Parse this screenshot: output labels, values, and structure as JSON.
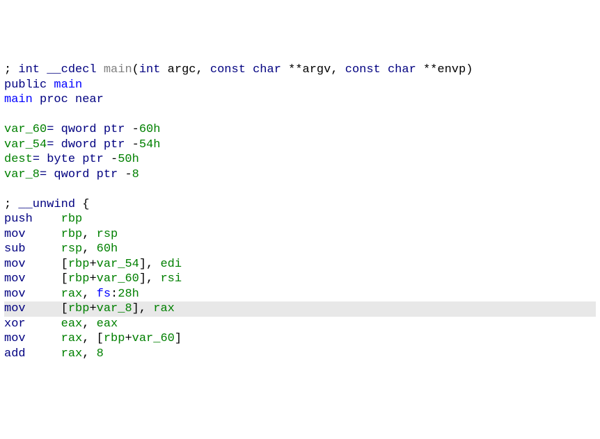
{
  "lines": [
    {
      "hl": false,
      "segs": [
        {
          "c": "t-black",
          "t": "; "
        },
        {
          "c": "t-navy",
          "t": "int"
        },
        {
          "c": "t-black",
          "t": " "
        },
        {
          "c": "t-navy",
          "t": "__cdecl"
        },
        {
          "c": "t-black",
          "t": " "
        },
        {
          "c": "t-gray",
          "t": "main"
        },
        {
          "c": "t-black",
          "t": "("
        },
        {
          "c": "t-navy",
          "t": "int"
        },
        {
          "c": "t-black",
          "t": " argc, "
        },
        {
          "c": "t-navy",
          "t": "const char"
        },
        {
          "c": "t-black",
          "t": " **argv, "
        },
        {
          "c": "t-navy",
          "t": "const char"
        },
        {
          "c": "t-black",
          "t": " **envp)"
        }
      ]
    },
    {
      "hl": false,
      "segs": [
        {
          "c": "t-navy",
          "t": "public"
        },
        {
          "c": "t-black",
          "t": " "
        },
        {
          "c": "t-blue",
          "t": "main"
        }
      ]
    },
    {
      "hl": false,
      "segs": [
        {
          "c": "t-blue",
          "t": "main"
        },
        {
          "c": "t-black",
          "t": " "
        },
        {
          "c": "t-navy",
          "t": "proc near"
        }
      ]
    },
    {
      "hl": false,
      "segs": [
        {
          "c": "t-black",
          "t": " "
        }
      ]
    },
    {
      "hl": false,
      "segs": [
        {
          "c": "t-green",
          "t": "var_60"
        },
        {
          "c": "t-navy",
          "t": "= qword ptr "
        },
        {
          "c": "t-black",
          "t": "-"
        },
        {
          "c": "t-green",
          "t": "60h"
        }
      ]
    },
    {
      "hl": false,
      "segs": [
        {
          "c": "t-green",
          "t": "var_54"
        },
        {
          "c": "t-navy",
          "t": "= dword ptr "
        },
        {
          "c": "t-black",
          "t": "-"
        },
        {
          "c": "t-green",
          "t": "54h"
        }
      ]
    },
    {
      "hl": false,
      "segs": [
        {
          "c": "t-green",
          "t": "dest"
        },
        {
          "c": "t-navy",
          "t": "= byte ptr "
        },
        {
          "c": "t-black",
          "t": "-"
        },
        {
          "c": "t-green",
          "t": "50h"
        }
      ]
    },
    {
      "hl": false,
      "segs": [
        {
          "c": "t-green",
          "t": "var_8"
        },
        {
          "c": "t-navy",
          "t": "= qword ptr "
        },
        {
          "c": "t-black",
          "t": "-"
        },
        {
          "c": "t-green",
          "t": "8"
        }
      ]
    },
    {
      "hl": false,
      "segs": [
        {
          "c": "t-black",
          "t": " "
        }
      ]
    },
    {
      "hl": false,
      "segs": [
        {
          "c": "t-black",
          "t": "; "
        },
        {
          "c": "t-navy",
          "t": "__unwind"
        },
        {
          "c": "t-black",
          "t": " {"
        }
      ]
    },
    {
      "hl": false,
      "segs": [
        {
          "c": "t-navy",
          "t": "push    "
        },
        {
          "c": "t-green",
          "t": "rbp"
        }
      ]
    },
    {
      "hl": false,
      "segs": [
        {
          "c": "t-navy",
          "t": "mov     "
        },
        {
          "c": "t-green",
          "t": "rbp"
        },
        {
          "c": "t-black",
          "t": ", "
        },
        {
          "c": "t-green",
          "t": "rsp"
        }
      ]
    },
    {
      "hl": false,
      "segs": [
        {
          "c": "t-navy",
          "t": "sub     "
        },
        {
          "c": "t-green",
          "t": "rsp"
        },
        {
          "c": "t-black",
          "t": ", "
        },
        {
          "c": "t-green",
          "t": "60h"
        }
      ]
    },
    {
      "hl": false,
      "segs": [
        {
          "c": "t-navy",
          "t": "mov     "
        },
        {
          "c": "t-black",
          "t": "["
        },
        {
          "c": "t-green",
          "t": "rbp"
        },
        {
          "c": "t-black",
          "t": "+"
        },
        {
          "c": "t-green",
          "t": "var_54"
        },
        {
          "c": "t-black",
          "t": "], "
        },
        {
          "c": "t-green",
          "t": "edi"
        }
      ]
    },
    {
      "hl": false,
      "segs": [
        {
          "c": "t-navy",
          "t": "mov     "
        },
        {
          "c": "t-black",
          "t": "["
        },
        {
          "c": "t-green",
          "t": "rbp"
        },
        {
          "c": "t-black",
          "t": "+"
        },
        {
          "c": "t-green",
          "t": "var_60"
        },
        {
          "c": "t-black",
          "t": "], "
        },
        {
          "c": "t-green",
          "t": "rsi"
        }
      ]
    },
    {
      "hl": false,
      "segs": [
        {
          "c": "t-navy",
          "t": "mov     "
        },
        {
          "c": "t-green",
          "t": "rax"
        },
        {
          "c": "t-black",
          "t": ", "
        },
        {
          "c": "t-blue",
          "t": "fs"
        },
        {
          "c": "t-black",
          "t": ":"
        },
        {
          "c": "t-green",
          "t": "28h"
        }
      ]
    },
    {
      "hl": true,
      "segs": [
        {
          "c": "t-navy",
          "t": "mov     "
        },
        {
          "c": "t-black",
          "t": "["
        },
        {
          "c": "t-green",
          "t": "rbp"
        },
        {
          "c": "t-black",
          "t": "+"
        },
        {
          "c": "t-green",
          "t": "var_8"
        },
        {
          "c": "t-black",
          "t": "], "
        },
        {
          "c": "t-green",
          "t": "rax"
        }
      ]
    },
    {
      "hl": false,
      "segs": [
        {
          "c": "t-navy",
          "t": "xor     "
        },
        {
          "c": "t-green",
          "t": "eax"
        },
        {
          "c": "t-black",
          "t": ", "
        },
        {
          "c": "t-green",
          "t": "eax"
        }
      ]
    },
    {
      "hl": false,
      "segs": [
        {
          "c": "t-navy",
          "t": "mov     "
        },
        {
          "c": "t-green",
          "t": "rax"
        },
        {
          "c": "t-black",
          "t": ", ["
        },
        {
          "c": "t-green",
          "t": "rbp"
        },
        {
          "c": "t-black",
          "t": "+"
        },
        {
          "c": "t-green",
          "t": "var_60"
        },
        {
          "c": "t-black",
          "t": "]"
        }
      ]
    },
    {
      "hl": false,
      "segs": [
        {
          "c": "t-navy",
          "t": "add     "
        },
        {
          "c": "t-green",
          "t": "rax"
        },
        {
          "c": "t-black",
          "t": ", "
        },
        {
          "c": "t-green",
          "t": "8"
        }
      ]
    }
  ]
}
